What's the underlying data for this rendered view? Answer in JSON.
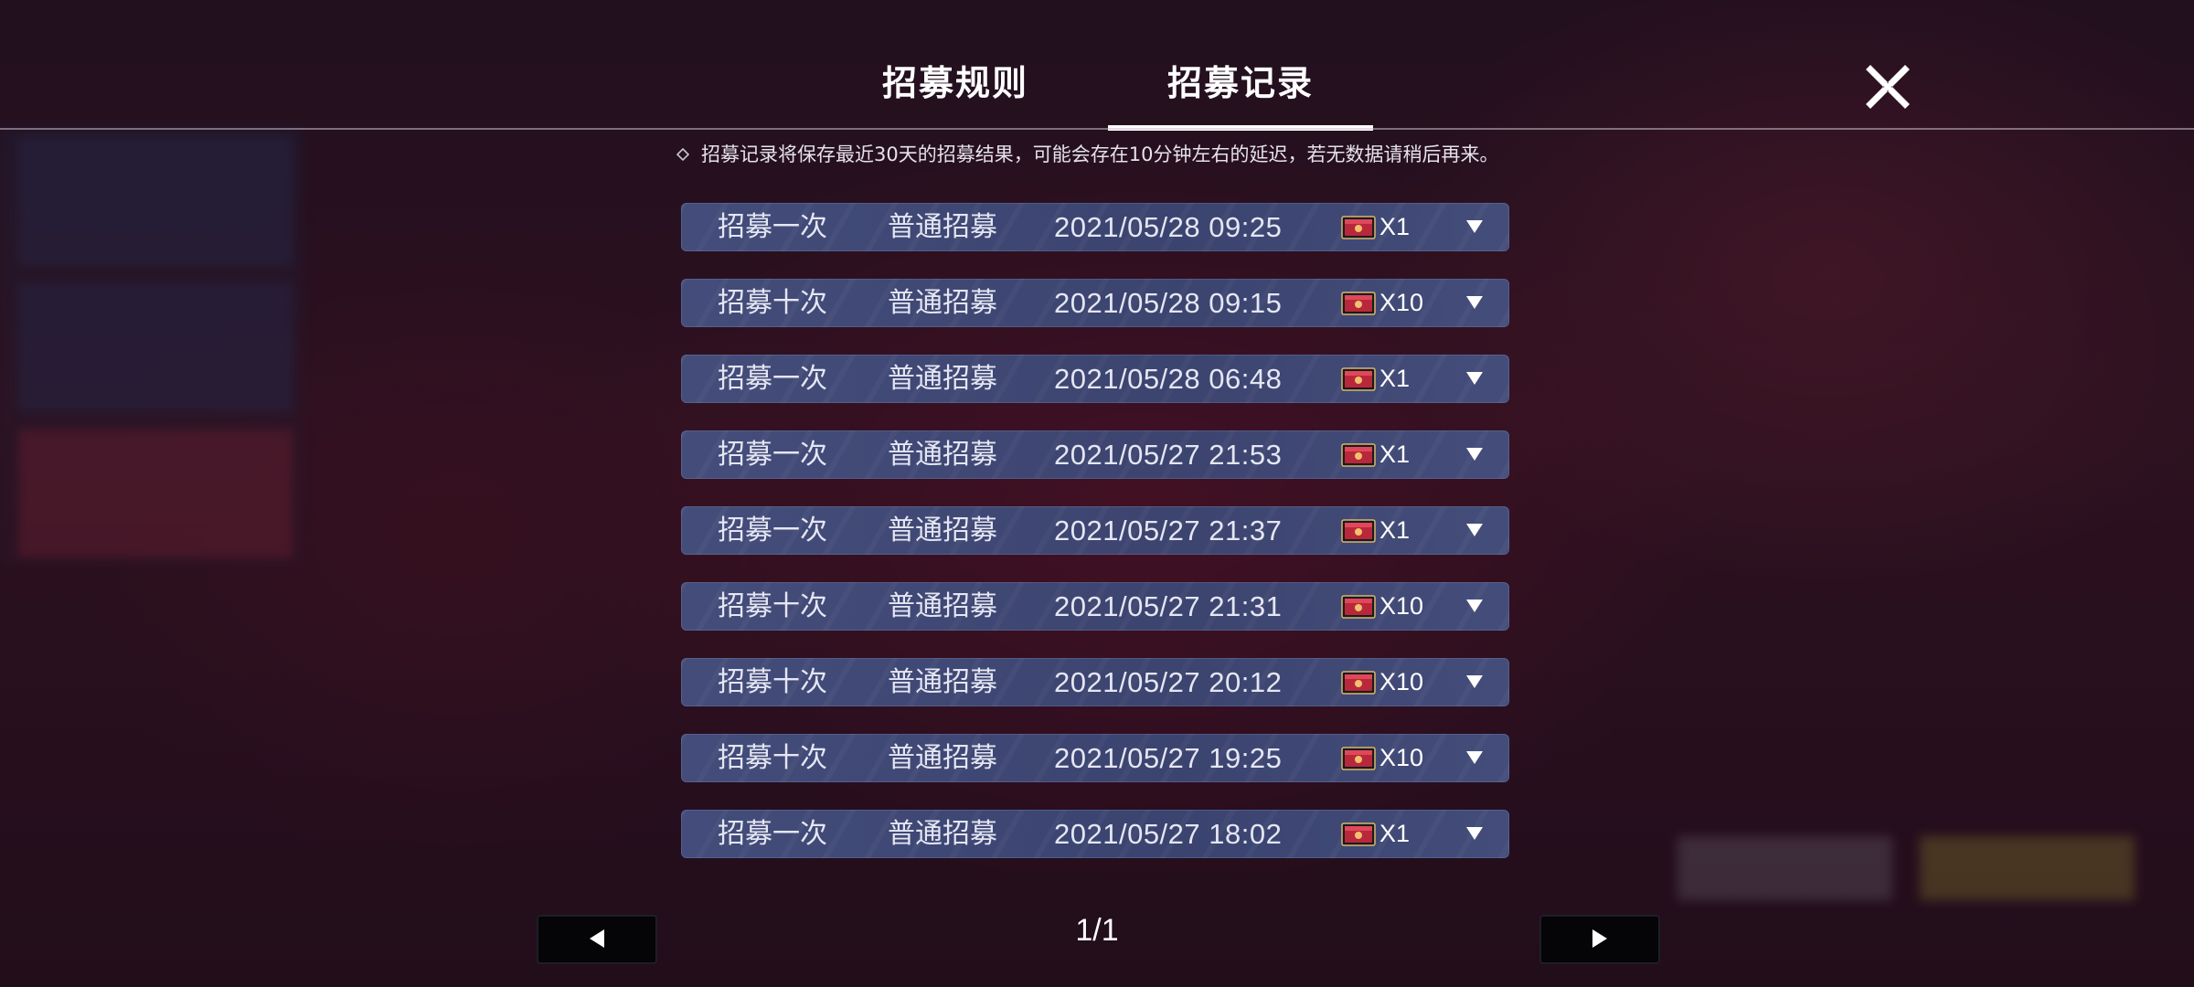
{
  "tabs": [
    {
      "label": "招募规则",
      "active": false
    },
    {
      "label": "招募记录",
      "active": true
    }
  ],
  "notice": {
    "icon": "diamond-bullet-icon",
    "text": "招募记录将保存最近30天的招募结果，可能会存在10分钟左右的延迟，若无数据请稍后再来。"
  },
  "records": [
    {
      "type": "招募一次",
      "pool": "普通招募",
      "time": "2021/05/28 09:25",
      "item_icon": "recruit-ticket-icon",
      "count": "X1"
    },
    {
      "type": "招募十次",
      "pool": "普通招募",
      "time": "2021/05/28 09:15",
      "item_icon": "recruit-ticket-icon",
      "count": "X10"
    },
    {
      "type": "招募一次",
      "pool": "普通招募",
      "time": "2021/05/28 06:48",
      "item_icon": "recruit-ticket-icon",
      "count": "X1"
    },
    {
      "type": "招募一次",
      "pool": "普通招募",
      "time": "2021/05/27 21:53",
      "item_icon": "recruit-ticket-icon",
      "count": "X1"
    },
    {
      "type": "招募一次",
      "pool": "普通招募",
      "time": "2021/05/27 21:37",
      "item_icon": "recruit-ticket-icon",
      "count": "X1"
    },
    {
      "type": "招募十次",
      "pool": "普通招募",
      "time": "2021/05/27 21:31",
      "item_icon": "recruit-ticket-icon",
      "count": "X10"
    },
    {
      "type": "招募十次",
      "pool": "普通招募",
      "time": "2021/05/27 20:12",
      "item_icon": "recruit-ticket-icon",
      "count": "X10"
    },
    {
      "type": "招募十次",
      "pool": "普通招募",
      "time": "2021/05/27 19:25",
      "item_icon": "recruit-ticket-icon",
      "count": "X10"
    },
    {
      "type": "招募一次",
      "pool": "普通招募",
      "time": "2021/05/27 18:02",
      "item_icon": "recruit-ticket-icon",
      "count": "X1"
    }
  ],
  "pagination": {
    "label": "1/1",
    "prev_icon": "triangle-left-icon",
    "next_icon": "triangle-right-icon"
  },
  "close_icon": "close-x-icon",
  "colors": {
    "row_bg": "#465282",
    "active_underline": "#ffffff",
    "ticket_red": "#b8283a"
  }
}
